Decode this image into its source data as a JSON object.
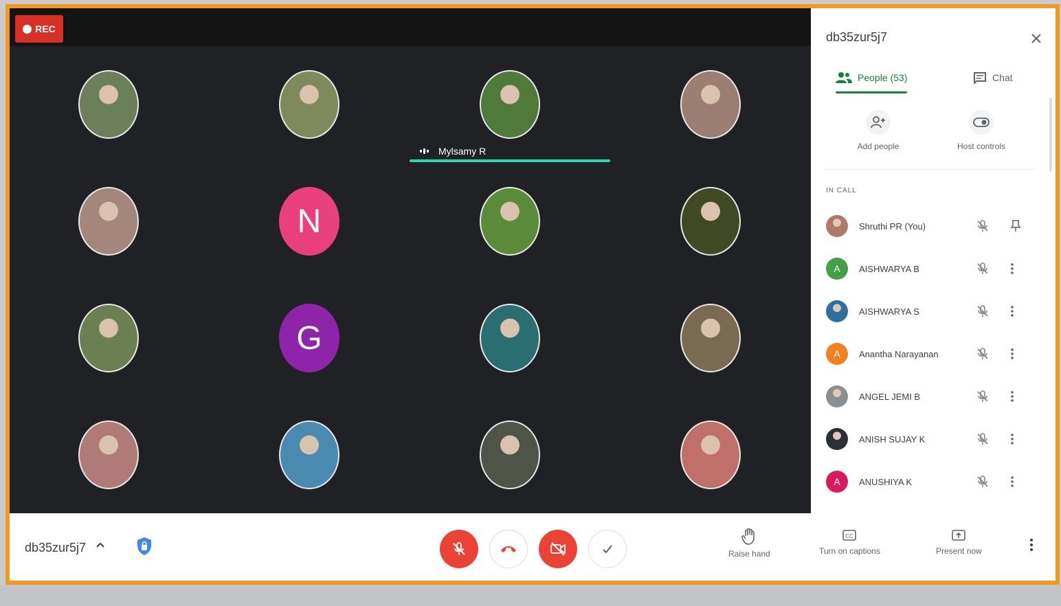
{
  "recording": {
    "label": "REC"
  },
  "stage": {
    "active_speaker": "Mylsamy R",
    "tiles": [
      {
        "name": "participant-photo",
        "kind": "photo",
        "color": "#6b7f5a"
      },
      {
        "name": "participant-photo",
        "kind": "photo",
        "color": "#7f8a5c"
      },
      {
        "name": "participant-photo",
        "kind": "photo",
        "color": "#4f7a3a"
      },
      {
        "name": "participant-photo",
        "kind": "photo",
        "color": "#9a7f72"
      },
      {
        "name": "participant-photo",
        "kind": "photo",
        "color": "#a4867a"
      },
      {
        "name": "participant-avatar-n",
        "kind": "letter",
        "letter": "N",
        "color": "#e8407a"
      },
      {
        "name": "participant-photo",
        "kind": "photo",
        "color": "#5a8a3a"
      },
      {
        "name": "participant-photo",
        "kind": "photo",
        "color": "#3f4a25"
      },
      {
        "name": "participant-photo",
        "kind": "photo",
        "color": "#6a8050"
      },
      {
        "name": "participant-avatar-g",
        "kind": "letter",
        "letter": "G",
        "color": "#8e24aa"
      },
      {
        "name": "participant-photo",
        "kind": "photo",
        "color": "#2a6e72"
      },
      {
        "name": "participant-photo",
        "kind": "photo",
        "color": "#7a6a52"
      },
      {
        "name": "participant-photo",
        "kind": "photo",
        "color": "#b07a78"
      },
      {
        "name": "participant-photo",
        "kind": "photo",
        "color": "#4a8ab0"
      },
      {
        "name": "participant-photo",
        "kind": "photo",
        "color": "#4e5548"
      },
      {
        "name": "participant-photo",
        "kind": "photo",
        "color": "#c0706a"
      }
    ]
  },
  "panel": {
    "meeting_code": "db35zur5j7",
    "tabs": {
      "people": "People (53)",
      "chat": "Chat"
    },
    "actions": {
      "add_people": "Add people",
      "host_controls": "Host controls"
    },
    "section_label": "IN CALL",
    "participants": [
      {
        "name": "Shruthi PR (You)",
        "avatar": "",
        "color": "#b07a6a",
        "action": "pin-icon"
      },
      {
        "name": "AISHWARYA B",
        "avatar": "A",
        "color": "#43a047",
        "action": "more-vert-icon"
      },
      {
        "name": "AISHWARYA S",
        "avatar": "",
        "color": "#2f6f9f",
        "action": "more-vert-icon"
      },
      {
        "name": "Anantha Narayanan",
        "avatar": "A",
        "color": "#f4811f",
        "action": "more-vert-icon"
      },
      {
        "name": "ANGEL JEMI B",
        "avatar": "",
        "color": "#8a8f94",
        "action": "more-vert-icon"
      },
      {
        "name": "ANISH SUJAY K",
        "avatar": "",
        "color": "#2b2f38",
        "action": "more-vert-icon"
      },
      {
        "name": "ANUSHIYA K",
        "avatar": "A",
        "color": "#d81b60",
        "action": "more-vert-icon"
      }
    ]
  },
  "bottom": {
    "meeting_code": "db35zur5j7",
    "raise_hand": "Raise hand",
    "captions": "Turn on captions",
    "present": "Present now"
  },
  "colors": {
    "frame": "#f39a1e",
    "stage": "#202124",
    "accent_green": "#188038",
    "danger": "#ea4335"
  }
}
